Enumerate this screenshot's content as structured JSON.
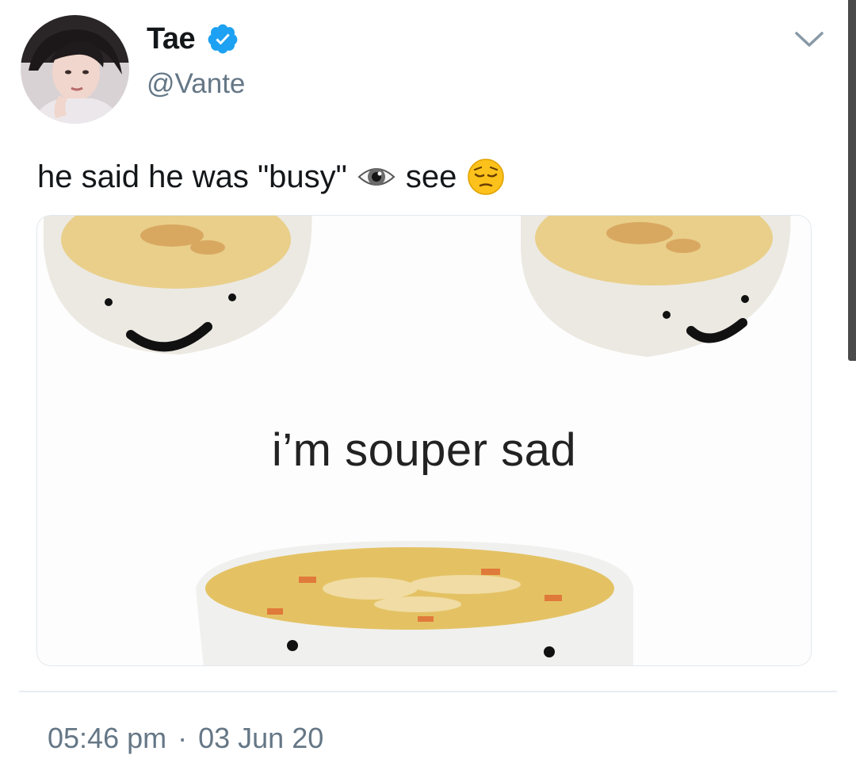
{
  "user": {
    "display_name": "Tae",
    "handle": "@Vante",
    "verified": true
  },
  "icons": {
    "verified": "verified-badge-icon",
    "caret": "chevron-down-icon",
    "eye": "eye-emoji",
    "pensive": "pensive-face-emoji"
  },
  "tweet": {
    "text_part1": "he said he was \"busy\"",
    "text_part2": "see"
  },
  "media": {
    "caption": "i’m souper sad"
  },
  "meta": {
    "time": "05:46 pm",
    "separator": "·",
    "date": "03 Jun 20"
  },
  "colors": {
    "verified_blue": "#1da1f2",
    "secondary_text": "#657786",
    "divider": "#e6ecf0"
  }
}
